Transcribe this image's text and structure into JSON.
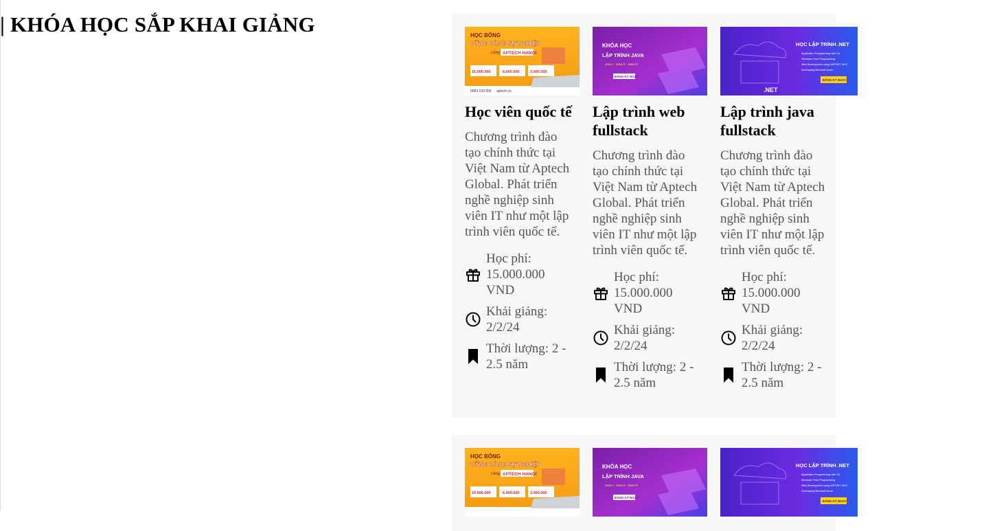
{
  "section": {
    "title": "| KHÓA HỌC SẮP KHAI GIẢNG"
  },
  "thumbs": {
    "scholarship": {
      "line1": "HỌC BỔNG",
      "line2": "VỮNG VÀNG SỰ NGHIỆP",
      "line3": "cùng",
      "line4": "APTECH HANOI",
      "amounts": [
        "15.000.000",
        "6.000.000",
        "3.000.000"
      ],
      "phone": "0983 630 656",
      "site": "aptech.vn"
    },
    "java": {
      "line1": "KHÓA HỌC",
      "line2": "LẬP TRÌNH JAVA",
      "line3": "Java I - Java II - Java III",
      "cta": "ĐĂNG KÝ NGAY"
    },
    "dotnet": {
      "title": "HỌC LẬP TRÌNH .NET",
      "bullets": [
        "Application Programming with C#",
        "Windows Form Programming",
        "Web Development using ASP.NET MVC",
        "Developing Microsoft Azure"
      ],
      "cta": "ĐĂNG KÝ NGAY",
      "logo": ".NET"
    }
  },
  "courses": [
    {
      "title": "Học viên quốc tế",
      "desc": "Chương trình đào tạo chính thức tại Việt Nam từ Aptech Global. Phát triển nghề nghiệp sinh viên IT như một lập trình viên quốc tế.",
      "fee": "Học phí: 15.000.000 VND",
      "start": "Khải giảng: 2/2/24",
      "duration": "Thời lượng: 2 - 2.5 năm"
    },
    {
      "title": "Lập trình web fullstack",
      "desc": "Chương trình đào tạo chính thức tại Việt Nam từ Aptech Global. Phát triển nghề nghiệp sinh viên IT như một lập trình viên quốc tế.",
      "fee": "Học phí: 15.000.000 VND",
      "start": "Khải giảng: 2/2/24",
      "duration": "Thời lượng: 2 - 2.5 năm"
    },
    {
      "title": "Lập trình java fullstack",
      "desc": "Chương trình đào tạo chính thức tại Việt Nam từ Aptech Global. Phát triển nghề nghiệp sinh viên IT như một lập trình viên quốc tế.",
      "fee": "Học phí: 15.000.000 VND",
      "start": "Khải giảng: 2/2/24",
      "duration": "Thời lượng: 2 - 2.5 năm"
    }
  ],
  "icons": {
    "fee": "gift-icon",
    "start": "clock-icon",
    "duration": "bookmark-icon"
  },
  "colors": {
    "panel": "#f7f7f7",
    "text_muted": "#555555",
    "banner_orange": "#f9a51a",
    "banner_purple": "#8a2be2",
    "banner_blue": "#3b2fd9"
  }
}
